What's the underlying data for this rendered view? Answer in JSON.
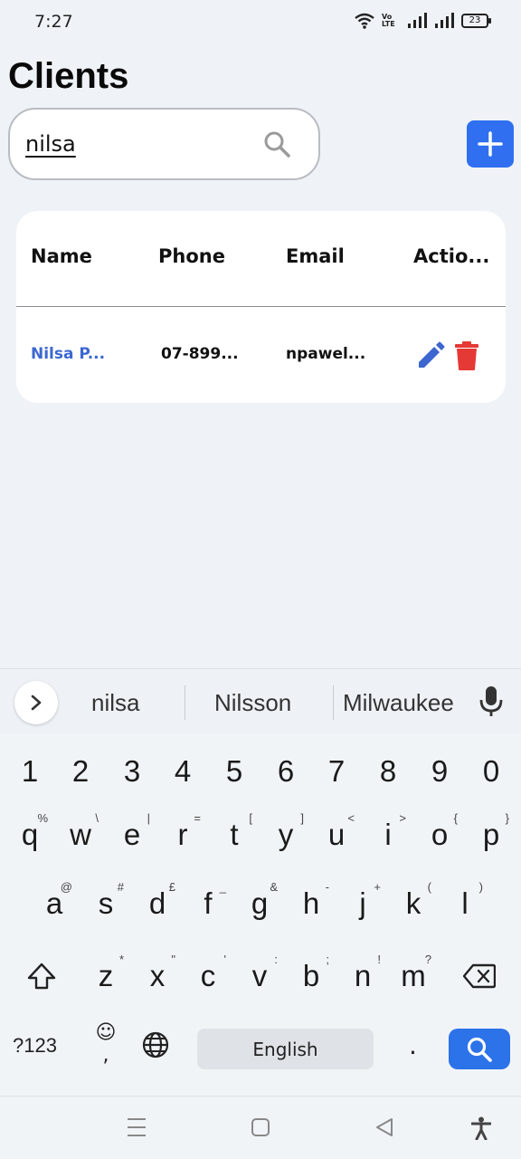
{
  "status_bar": {
    "time": "7:27",
    "network_label": "Vo LTE",
    "battery": "23"
  },
  "page": {
    "title": "Clients"
  },
  "search": {
    "value": "nilsa",
    "icon": "search-icon"
  },
  "add_button": {
    "icon": "plus-icon",
    "color": "#2f6ff0"
  },
  "table": {
    "columns": [
      "Name",
      "Phone",
      "Email",
      "Actio..."
    ],
    "rows": [
      {
        "name": "Nilsa P...",
        "phone": "07-899...",
        "email": "npawel...",
        "actions": [
          "pencil-icon",
          "trash-icon"
        ]
      }
    ],
    "name_color": "#3c67d0",
    "edit_color": "#3c67d0",
    "delete_color": "#e53935"
  },
  "keyboard": {
    "suggestions": [
      "nilsa",
      "Nilsson",
      "Milwaukee"
    ],
    "number_row": [
      "1",
      "2",
      "3",
      "4",
      "5",
      "6",
      "7",
      "8",
      "9",
      "0"
    ],
    "row1": [
      {
        "key": "q",
        "hint": "%"
      },
      {
        "key": "w",
        "hint": "\\"
      },
      {
        "key": "e",
        "hint": "|"
      },
      {
        "key": "r",
        "hint": "="
      },
      {
        "key": "t",
        "hint": "["
      },
      {
        "key": "y",
        "hint": "]"
      },
      {
        "key": "u",
        "hint": "<"
      },
      {
        "key": "i",
        "hint": ">"
      },
      {
        "key": "o",
        "hint": "{"
      },
      {
        "key": "p",
        "hint": "}"
      }
    ],
    "row2": [
      {
        "key": "a",
        "hint": "@"
      },
      {
        "key": "s",
        "hint": "#"
      },
      {
        "key": "d",
        "hint": "£"
      },
      {
        "key": "f",
        "hint": "_"
      },
      {
        "key": "g",
        "hint": "&"
      },
      {
        "key": "h",
        "hint": "-"
      },
      {
        "key": "j",
        "hint": "+"
      },
      {
        "key": "k",
        "hint": "("
      },
      {
        "key": "l",
        "hint": ")"
      }
    ],
    "row3": [
      {
        "key": "z",
        "hint": "*"
      },
      {
        "key": "x",
        "hint": "\""
      },
      {
        "key": "c",
        "hint": "'"
      },
      {
        "key": "v",
        "hint": ":"
      },
      {
        "key": "b",
        "hint": ";"
      },
      {
        "key": "n",
        "hint": "!"
      },
      {
        "key": "m",
        "hint": "?"
      }
    ],
    "symbols_label": "?123",
    "emoji_key": "☺",
    "comma_key": ",",
    "space_label": "English",
    "period_key": ".",
    "action_color": "#2c72e9"
  },
  "nav_bar": {
    "icons": [
      "menu-icon",
      "home-icon",
      "back-icon",
      "accessibility-icon"
    ]
  }
}
